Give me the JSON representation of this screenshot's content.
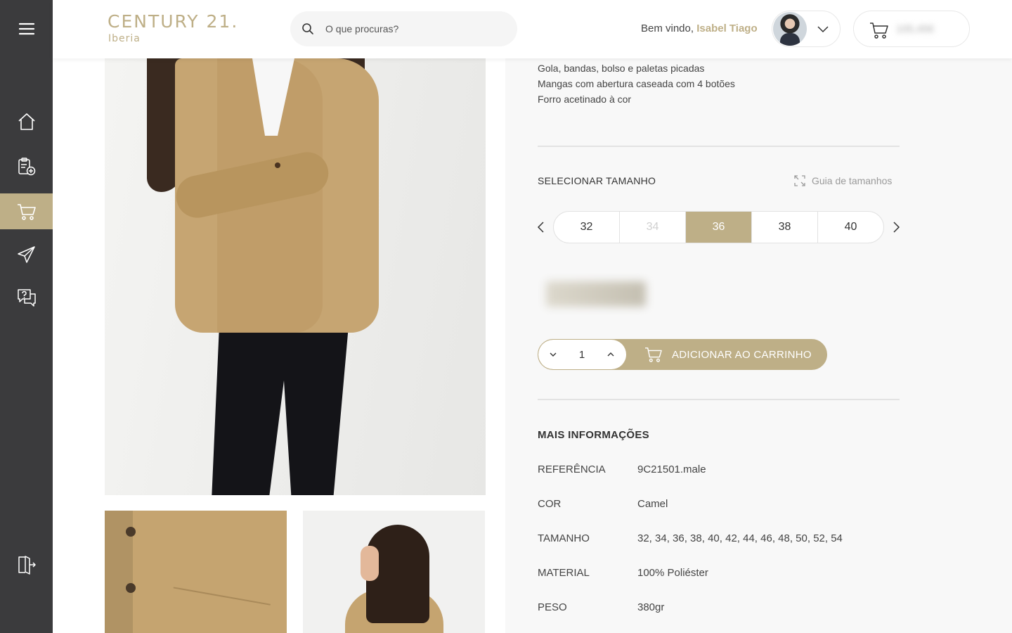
{
  "header": {
    "logo_main": "CENTURY 21.",
    "logo_sub": "Iberia",
    "search_placeholder": "O que procuras?",
    "welcome_prefix": "Bem vindo,",
    "user_name": "Isabel Tiago",
    "cart_total": "105,45€"
  },
  "sidebar": {
    "items": [
      "menu-icon",
      "home-icon",
      "add-order-icon",
      "cart-icon",
      "send-icon",
      "help-chat-icon",
      "logout-icon"
    ],
    "active": "cart-icon"
  },
  "product": {
    "description_lines": [
      "Gola, bandas, bolso e paletas picadas",
      "Mangas com abertura caseada com 4 botões",
      "Forro acetinado à cor"
    ],
    "size_title": "SELECIONAR TAMANHO",
    "size_guide": "Guia de tamanhos",
    "sizes": [
      "32",
      "34",
      "36",
      "38",
      "40"
    ],
    "selected_size": "36",
    "disabled_sizes": [
      "34"
    ],
    "quantity": "1",
    "add_to_cart": "ADICIONAR AO CARRINHO"
  },
  "more_info": {
    "title": "MAIS INFORMAÇÕES",
    "rows": [
      {
        "label": "REFERÊNCIA",
        "value": "9C21501.male"
      },
      {
        "label": "COR",
        "value": "Camel"
      },
      {
        "label": "TAMANHO",
        "value": "32, 34, 36, 38, 40, 42, 44, 46, 48, 50, 52, 54"
      },
      {
        "label": "MATERIAL",
        "value": "100% Poliéster"
      },
      {
        "label": "PESO",
        "value": "380gr"
      }
    ]
  },
  "colors": {
    "accent": "#beaf87",
    "sidebar": "#3b3b3d"
  }
}
